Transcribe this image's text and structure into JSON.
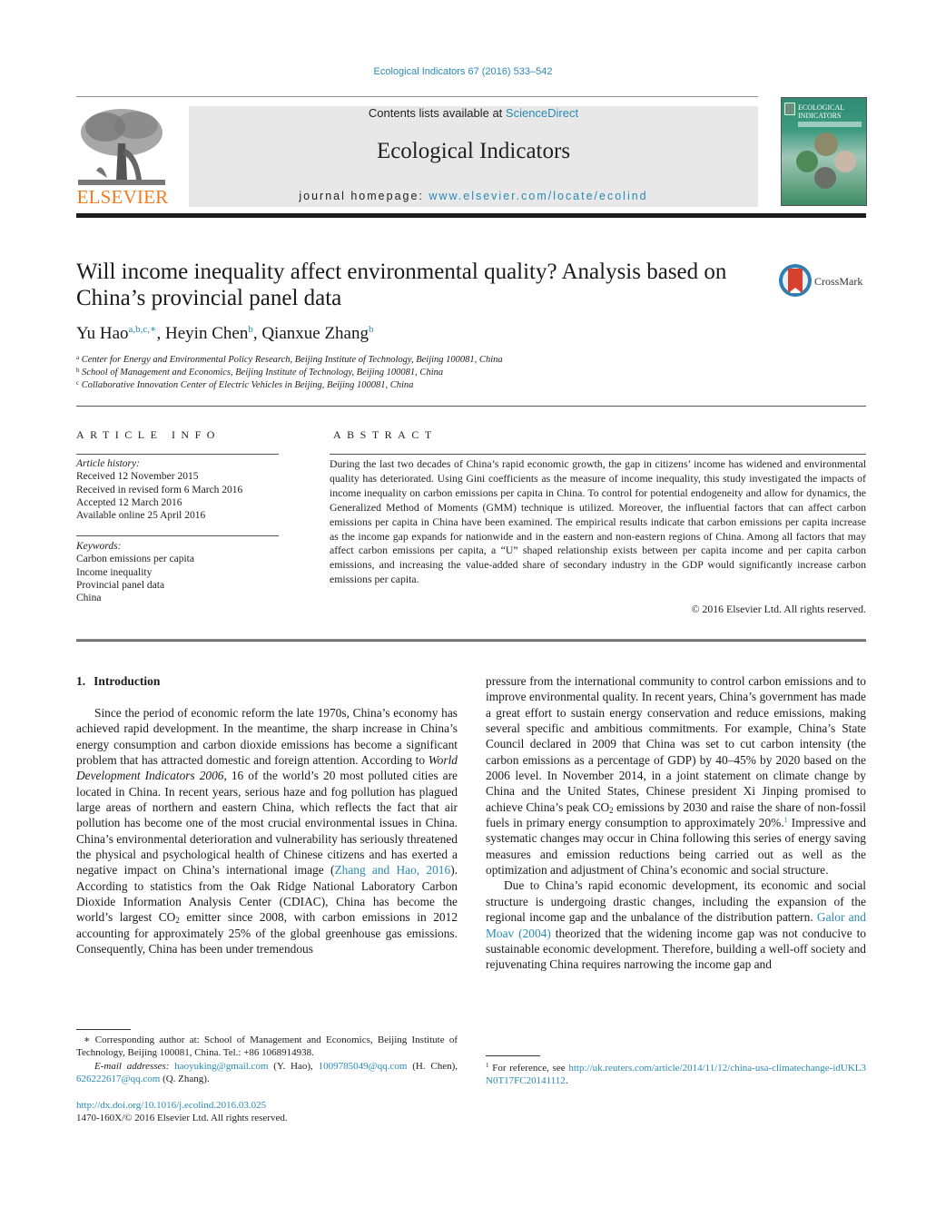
{
  "header": {
    "journal_ref": "Ecological Indicators 67 (2016) 533–542",
    "contents_prefix": "Contents lists available at ",
    "contents_link": "ScienceDirect",
    "journal_title": "Ecological Indicators",
    "homepage_prefix": "journal homepage: ",
    "homepage_link": "www.elsevier.com/locate/ecolind",
    "publisher_logo_text": "ELSEVIER",
    "cover_title_line1": "ECOLOGICAL",
    "cover_title_line2": "INDICATORS",
    "crossmark_label": "CrossMark",
    "colors": {
      "link": "#2a8ab5",
      "elsevier_orange": "#f07c1f",
      "banner_bg": "#e8e8e8"
    }
  },
  "article": {
    "title": "Will income inequality affect environmental quality? Analysis based on China’s provincial panel data",
    "authors": [
      {
        "name": "Yu Hao",
        "marks": "a,b,c,∗"
      },
      {
        "name": "Heyin Chen",
        "marks": "b"
      },
      {
        "name": "Qianxue Zhang",
        "marks": "b"
      }
    ],
    "affiliations": [
      {
        "mark": "a",
        "text": "Center for Energy and Environmental Policy Research, Beijing Institute of Technology, Beijing 100081, China"
      },
      {
        "mark": "b",
        "text": "School of Management and Economics, Beijing Institute of Technology, Beijing 100081, China"
      },
      {
        "mark": "c",
        "text": "Collaborative Innovation Center of Electric Vehicles in Beijing, Beijing 100081, China"
      }
    ]
  },
  "article_info": {
    "heading": "ARTICLE INFO",
    "history_label": "Article history:",
    "history": [
      "Received 12 November 2015",
      "Received in revised form 6 March 2016",
      "Accepted 12 March 2016",
      "Available online 25 April 2016"
    ],
    "keywords_label": "Keywords:",
    "keywords": [
      "Carbon emissions per capita",
      "Income inequality",
      "Provincial panel data",
      "China"
    ]
  },
  "abstract": {
    "heading": "ABSTRACT",
    "text": "During the last two decades of China’s rapid economic growth, the gap in citizens’ income has widened and environmental quality has deteriorated. Using Gini coefficients as the measure of income inequality, this study investigated the impacts of income inequality on carbon emissions per capita in China. To control for potential endogeneity and allow for dynamics, the Generalized Method of Moments (GMM) technique is utilized. Moreover, the influential factors that can affect carbon emissions per capita in China have been examined. The empirical results indicate that carbon emissions per capita increase as the income gap expands for nationwide and in the eastern and non-eastern regions of China. Among all factors that may affect carbon emissions per capita, a “U” shaped relationship exists between per capita income and per capita carbon emissions, and increasing the value-added share of secondary industry in the GDP would significantly increase carbon emissions per capita.",
    "copyright": "© 2016 Elsevier Ltd. All rights reserved."
  },
  "body": {
    "section_number": "1.",
    "section_title": "Introduction",
    "left_p1_a": "Since the period of economic reform the late 1970s, China’s economy has achieved rapid development. In the meantime, the sharp increase in China’s energy consumption and carbon dioxide emissions has become a significant problem that has attracted domestic and foreign attention. According to ",
    "left_p1_ital": "World Development Indicators 2006",
    "left_p1_b": ", 16 of the world’s 20 most polluted cities are located in China. In recent years, serious haze and fog pollution has plagued large areas of northern and eastern China, which reflects the fact that air pollution has become one of the most crucial environmental issues in China. China’s environmental deterioration and vulnerability has seriously threatened the physical and psychological health of Chinese citizens and has exerted a negative impact on China’s international image (",
    "left_p1_cite": "Zhang and Hao, 2016",
    "left_p1_c": "). According to statistics from the Oak Ridge National Laboratory Carbon Dioxide Information Analysis Center (CDIAC), China has become the world’s largest CO",
    "left_p1_sub": "2",
    "left_p1_d": " emitter since 2008, with carbon emissions in 2012 accounting for approximately 25% of the global greenhouse gas emissions. Consequently, China has been under tremendous",
    "right_p1_a": "pressure from the international community to control carbon emissions and to improve environmental quality. In recent years, China’s government has made a great effort to sustain energy conservation and reduce emissions, making several specific and ambitious commitments. For example, China’s State Council declared in 2009 that China was set to cut carbon intensity (the carbon emissions as a percentage of GDP) by 40–45% by 2020 based on the 2006 level. In November 2014, in a joint statement on climate change by China and the United States, Chinese president Xi Jinping promised to achieve China’s peak CO",
    "right_p1_sub": "2",
    "right_p1_b": " emissions by 2030 and raise the share of non-fossil fuels in primary energy consumption to approximately 20%.",
    "right_p1_fn": "1",
    "right_p1_c": " Impressive and systematic changes may occur in China following this series of energy saving measures and emission reductions being carried out as well as the optimization and adjustment of China’s economic and social structure.",
    "right_p2_a": "Due to China’s rapid economic development, its economic and social structure is undergoing drastic changes, including the expansion of the regional income gap and the unbalance of the distribution pattern. ",
    "right_p2_cite": "Galor and Moav (2004)",
    "right_p2_b": " theorized that the widening income gap was not conducive to sustainable economic development. Therefore, building a well-off society and rejuvenating China requires narrowing the income gap and"
  },
  "footnotes": {
    "corresponding": "∗ Corresponding author at: School of Management and Economics, Beijing Institute of Technology, Beijing 100081, China. Tel.: +86 1068914938.",
    "email_label": "E-mail addresses: ",
    "email1": "haoyuking@gmail.com",
    "email1_owner": " (Y. Hao), ",
    "email2": "1009785049@qq.com",
    "email2_owner": " (H. Chen), ",
    "email3": "626222617@qq.com",
    "email3_owner": " (Q. Zhang).",
    "fn1_mark": "1",
    "fn1_prefix": " For reference, see ",
    "fn1_link": "http://uk.reuters.com/article/2014/11/12/china-usa-climatechange-idUKL3N0T17FC20141112",
    "fn1_suffix": ".",
    "doi": "http://dx.doi.org/10.1016/j.ecolind.2016.03.025",
    "issn": "1470-160X/© 2016 Elsevier Ltd. All rights reserved."
  }
}
